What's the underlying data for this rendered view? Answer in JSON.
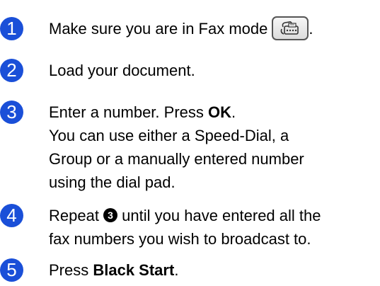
{
  "colors": {
    "badge": "#1a4fd8",
    "text": "#000000"
  },
  "steps": [
    {
      "number": "1",
      "text": "Make sure you are in Fax mode",
      "suffix": ".",
      "icon": "fax-mode-button-icon"
    },
    {
      "number": "2",
      "text": "Load your document."
    },
    {
      "number": "3",
      "text_before": "Enter a number. Press ",
      "bold": "OK",
      "text_after": ".",
      "line2": "You can use either a Speed-Dial, a",
      "line3": "Group or a manually entered number",
      "line4": "using the dial pad."
    },
    {
      "number": "4",
      "text_before": "Repeat ",
      "ref": "3",
      "text_after": " until you have entered all the",
      "line2": "fax numbers you wish to broadcast to."
    },
    {
      "number": "5",
      "text_before": "Press ",
      "bold": "Black Start",
      "text_after": "."
    }
  ]
}
